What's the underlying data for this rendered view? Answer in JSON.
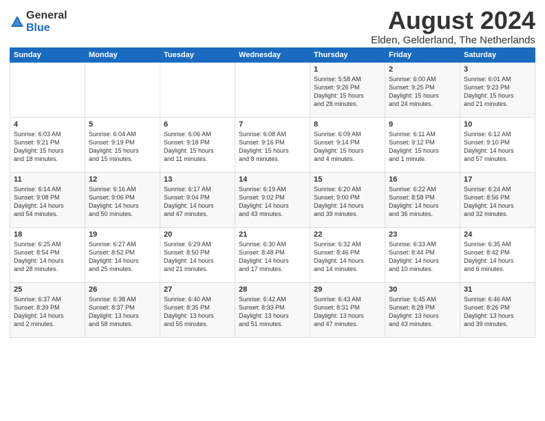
{
  "logo": {
    "general": "General",
    "blue": "Blue"
  },
  "title": "August 2024",
  "subtitle": "Elden, Gelderland, The Netherlands",
  "weekdays": [
    "Sunday",
    "Monday",
    "Tuesday",
    "Wednesday",
    "Thursday",
    "Friday",
    "Saturday"
  ],
  "weeks": [
    [
      {
        "day": "",
        "content": ""
      },
      {
        "day": "",
        "content": ""
      },
      {
        "day": "",
        "content": ""
      },
      {
        "day": "",
        "content": ""
      },
      {
        "day": "1",
        "content": "Sunrise: 5:58 AM\nSunset: 9:26 PM\nDaylight: 15 hours\nand 28 minutes."
      },
      {
        "day": "2",
        "content": "Sunrise: 6:00 AM\nSunset: 9:25 PM\nDaylight: 15 hours\nand 24 minutes."
      },
      {
        "day": "3",
        "content": "Sunrise: 6:01 AM\nSunset: 9:23 PM\nDaylight: 15 hours\nand 21 minutes."
      }
    ],
    [
      {
        "day": "4",
        "content": "Sunrise: 6:03 AM\nSunset: 9:21 PM\nDaylight: 15 hours\nand 18 minutes."
      },
      {
        "day": "5",
        "content": "Sunrise: 6:04 AM\nSunset: 9:19 PM\nDaylight: 15 hours\nand 15 minutes."
      },
      {
        "day": "6",
        "content": "Sunrise: 6:06 AM\nSunset: 9:18 PM\nDaylight: 15 hours\nand 11 minutes."
      },
      {
        "day": "7",
        "content": "Sunrise: 6:08 AM\nSunset: 9:16 PM\nDaylight: 15 hours\nand 8 minutes."
      },
      {
        "day": "8",
        "content": "Sunrise: 6:09 AM\nSunset: 9:14 PM\nDaylight: 15 hours\nand 4 minutes."
      },
      {
        "day": "9",
        "content": "Sunrise: 6:11 AM\nSunset: 9:12 PM\nDaylight: 15 hours\nand 1 minute."
      },
      {
        "day": "10",
        "content": "Sunrise: 6:12 AM\nSunset: 9:10 PM\nDaylight: 14 hours\nand 57 minutes."
      }
    ],
    [
      {
        "day": "11",
        "content": "Sunrise: 6:14 AM\nSunset: 9:08 PM\nDaylight: 14 hours\nand 54 minutes."
      },
      {
        "day": "12",
        "content": "Sunrise: 6:16 AM\nSunset: 9:06 PM\nDaylight: 14 hours\nand 50 minutes."
      },
      {
        "day": "13",
        "content": "Sunrise: 6:17 AM\nSunset: 9:04 PM\nDaylight: 14 hours\nand 47 minutes."
      },
      {
        "day": "14",
        "content": "Sunrise: 6:19 AM\nSunset: 9:02 PM\nDaylight: 14 hours\nand 43 minutes."
      },
      {
        "day": "15",
        "content": "Sunrise: 6:20 AM\nSunset: 9:00 PM\nDaylight: 14 hours\nand 39 minutes."
      },
      {
        "day": "16",
        "content": "Sunrise: 6:22 AM\nSunset: 8:58 PM\nDaylight: 14 hours\nand 36 minutes."
      },
      {
        "day": "17",
        "content": "Sunrise: 6:24 AM\nSunset: 8:56 PM\nDaylight: 14 hours\nand 32 minutes."
      }
    ],
    [
      {
        "day": "18",
        "content": "Sunrise: 6:25 AM\nSunset: 8:54 PM\nDaylight: 14 hours\nand 28 minutes."
      },
      {
        "day": "19",
        "content": "Sunrise: 6:27 AM\nSunset: 8:52 PM\nDaylight: 14 hours\nand 25 minutes."
      },
      {
        "day": "20",
        "content": "Sunrise: 6:29 AM\nSunset: 8:50 PM\nDaylight: 14 hours\nand 21 minutes."
      },
      {
        "day": "21",
        "content": "Sunrise: 6:30 AM\nSunset: 8:48 PM\nDaylight: 14 hours\nand 17 minutes."
      },
      {
        "day": "22",
        "content": "Sunrise: 6:32 AM\nSunset: 8:46 PM\nDaylight: 14 hours\nand 14 minutes."
      },
      {
        "day": "23",
        "content": "Sunrise: 6:33 AM\nSunset: 8:44 PM\nDaylight: 14 hours\nand 10 minutes."
      },
      {
        "day": "24",
        "content": "Sunrise: 6:35 AM\nSunset: 8:42 PM\nDaylight: 14 hours\nand 6 minutes."
      }
    ],
    [
      {
        "day": "25",
        "content": "Sunrise: 6:37 AM\nSunset: 8:39 PM\nDaylight: 14 hours\nand 2 minutes."
      },
      {
        "day": "26",
        "content": "Sunrise: 6:38 AM\nSunset: 8:37 PM\nDaylight: 13 hours\nand 58 minutes."
      },
      {
        "day": "27",
        "content": "Sunrise: 6:40 AM\nSunset: 8:35 PM\nDaylight: 13 hours\nand 55 minutes."
      },
      {
        "day": "28",
        "content": "Sunrise: 6:42 AM\nSunset: 8:33 PM\nDaylight: 13 hours\nand 51 minutes."
      },
      {
        "day": "29",
        "content": "Sunrise: 6:43 AM\nSunset: 8:31 PM\nDaylight: 13 hours\nand 47 minutes."
      },
      {
        "day": "30",
        "content": "Sunrise: 6:45 AM\nSunset: 8:28 PM\nDaylight: 13 hours\nand 43 minutes."
      },
      {
        "day": "31",
        "content": "Sunrise: 6:46 AM\nSunset: 8:26 PM\nDaylight: 13 hours\nand 39 minutes."
      }
    ]
  ]
}
